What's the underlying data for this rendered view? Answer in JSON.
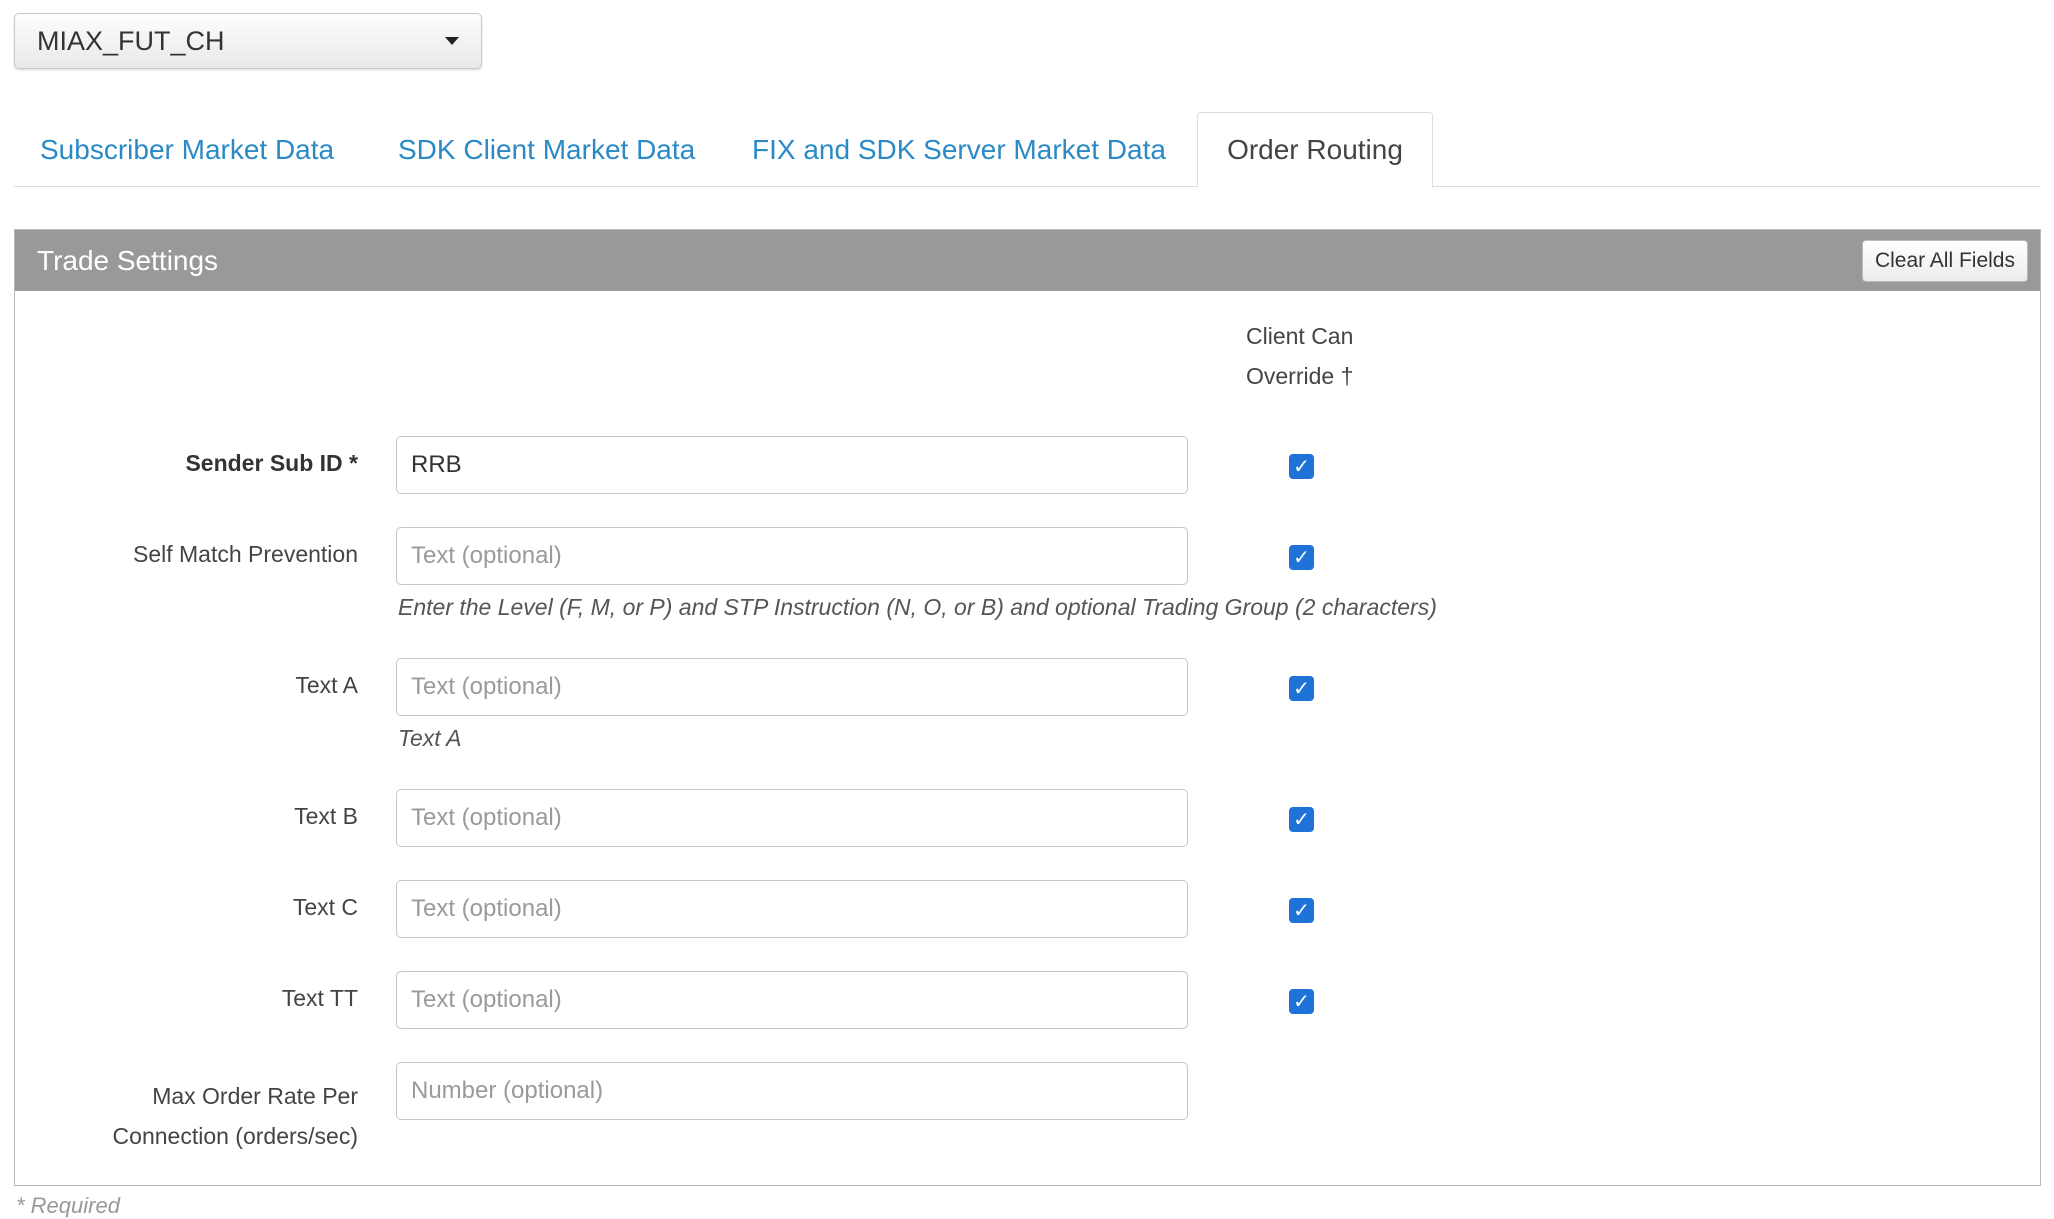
{
  "exchange_select": {
    "value": "MIAX_FUT_CH"
  },
  "tabs": [
    {
      "label": "Subscriber Market Data",
      "active": false
    },
    {
      "label": "SDK Client Market Data",
      "active": false
    },
    {
      "label": "FIX and SDK Server Market Data",
      "active": false
    },
    {
      "label": "Order Routing",
      "active": true
    }
  ],
  "panel": {
    "title": "Trade Settings",
    "clear_button": "Clear All Fields",
    "override_header_line1": "Client Can",
    "override_header_line2": "Override †"
  },
  "fields": [
    {
      "label": "Sender Sub ID *",
      "value": "RRB",
      "placeholder": "",
      "override_checked": true
    },
    {
      "label": "Self Match Prevention",
      "value": "",
      "placeholder": "Text (optional)",
      "override_checked": true,
      "help": "Enter the Level (F, M, or P) and STP Instruction (N, O, or B) and optional Trading Group (2 characters)"
    },
    {
      "label": "Text A",
      "value": "",
      "placeholder": "Text (optional)",
      "override_checked": true,
      "help": "Text A"
    },
    {
      "label": "Text B",
      "value": "",
      "placeholder": "Text (optional)",
      "override_checked": true
    },
    {
      "label": "Text C",
      "value": "",
      "placeholder": "Text (optional)",
      "override_checked": true
    },
    {
      "label": "Text TT",
      "value": "",
      "placeholder": "Text (optional)",
      "override_checked": true
    },
    {
      "label_line1": "Max Order Rate Per",
      "label_line2": "Connection (orders/sec)",
      "value": "",
      "placeholder": "Number (optional)"
    }
  ],
  "footer": {
    "required_note": "* Required"
  },
  "colors": {
    "link": "#2b8ac6",
    "panel_header": "#999999",
    "checkbox": "#1f73d8"
  },
  "icons": {
    "select_caret": "caret-down-icon",
    "checkbox": "checkmark-icon"
  }
}
